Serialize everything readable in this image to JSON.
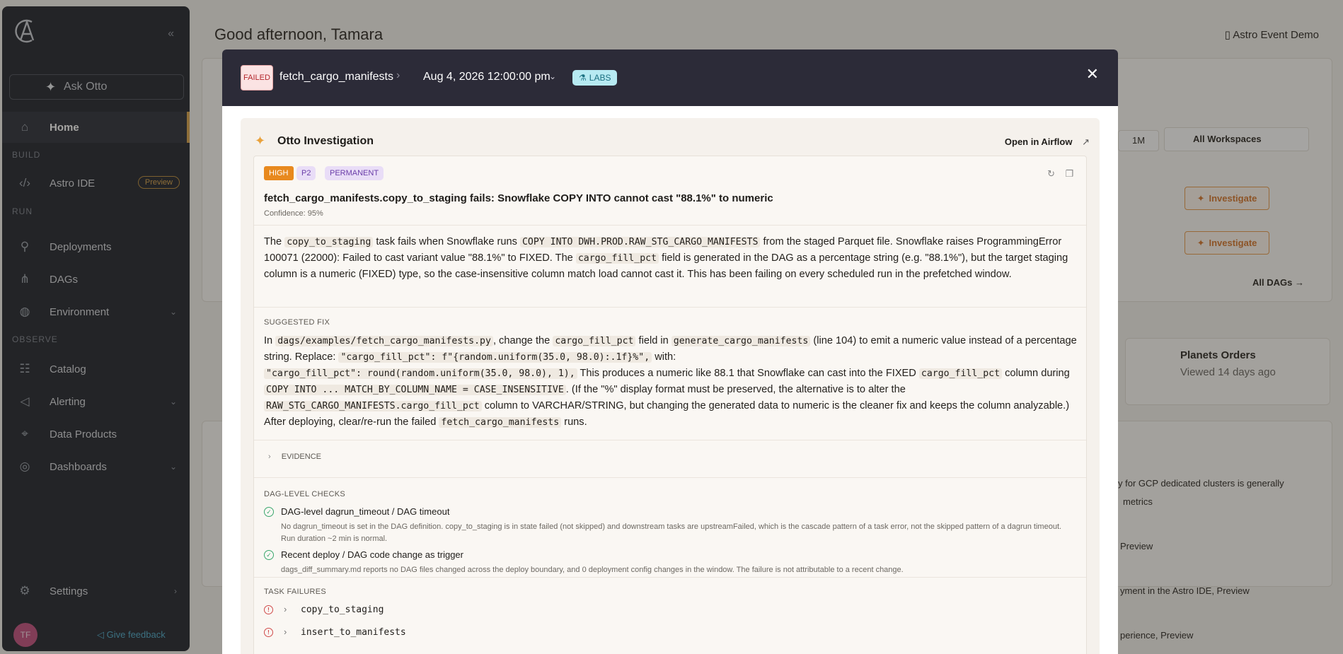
{
  "sidebar": {
    "ask_label": "Ask Otto",
    "sections": [
      "BUILD",
      "RUN",
      "OBSERVE"
    ],
    "items": [
      {
        "label": "Home"
      },
      {
        "label": "Astro IDE",
        "badge": "Preview"
      },
      {
        "label": "Deployments"
      },
      {
        "label": "DAGs"
      },
      {
        "label": "Environment"
      },
      {
        "label": "Catalog"
      },
      {
        "label": "Alerting"
      },
      {
        "label": "Data Products"
      },
      {
        "label": "Dashboards"
      },
      {
        "label": "Settings"
      }
    ],
    "avatar_initials": "TF",
    "feedback_label": "Give feedback"
  },
  "background": {
    "greeting": "Good afternoon, Tamara",
    "org_name": "Astro Event Demo",
    "range_1m": "1M",
    "workspaces": "All Workspaces",
    "investigate_label": "Investigate",
    "all_dags": "All DAGs",
    "planets_title": "Planets Orders",
    "planets_sub": "Viewed 14 days ago",
    "news_1": "y for GCP dedicated clusters is generally",
    "news_2": "metrics",
    "news_3": "Preview",
    "news_4": "yment in the Astro IDE, Preview",
    "news_5": "perience, Preview"
  },
  "modal": {
    "status": "FAILED",
    "dag_id": "fetch_cargo_manifests",
    "run_date": "Aug 4, 2026 12:00:00 pm",
    "labs_label": "LABS",
    "panel_title": "Otto Investigation",
    "open_airflow": "Open in Airflow",
    "tags": {
      "severity": "HIGH",
      "priority": "P2",
      "kind": "PERMANENT"
    },
    "finding_title": "fetch_cargo_manifests.copy_to_staging fails: Snowflake COPY INTO cannot cast \"88.1%\" to numeric",
    "confidence": "Confidence: 95%",
    "summary": {
      "t1": "The ",
      "c1": "copy_to_staging",
      "t2": " task fails when Snowflake runs ",
      "c2": "COPY INTO DWH.PROD.RAW_STG_CARGO_MANIFESTS",
      "t3": " from the staged Parquet file. Snowflake raises ProgrammingError 100071 (22000): Failed to cast variant value \"88.1%\" to FIXED. The ",
      "c3": "cargo_fill_pct",
      "t4": " field is generated in the DAG as a percentage string (e.g. \"88.1%\"), but the target staging column is a numeric (FIXED) type, so the case-insensitive column match load cannot cast it. This has been failing on every scheduled run in the prefetched window."
    },
    "suggested_fix_label": "SUGGESTED FIX",
    "fix": {
      "t1": "In ",
      "c1": "dags/examples/fetch_cargo_manifests.py",
      "t2": ", change the ",
      "c2": "cargo_fill_pct",
      "t3": " field in ",
      "c3": "generate_cargo_manifests",
      "t4": " (line 104) to emit a numeric value instead of a percentage string. Replace: ",
      "c4": "\"cargo_fill_pct\": f\"{random.uniform(35.0, 98.0):.1f}%\",",
      "t5": " with:",
      "c5": "\"cargo_fill_pct\": round(random.uniform(35.0, 98.0), 1),",
      "t6": " This produces a numeric like 88.1 that Snowflake can cast into the FIXED ",
      "c6": "cargo_fill_pct",
      "t7": " column during ",
      "c7": "COPY INTO ... MATCH_BY_COLUMN_NAME = CASE_INSENSITIVE",
      "t8": ". (If the \"%\" display format must be preserved, the alternative is to alter the ",
      "c8": "RAW_STG_CARGO_MANIFESTS.cargo_fill_pct",
      "t9": " column to VARCHAR/STRING, but changing the generated data to numeric is the cleaner fix and keeps the column analyzable.) After deploying, clear/re-run the failed ",
      "c9": "fetch_cargo_manifests",
      "t10": " runs."
    },
    "evidence_label": "EVIDENCE",
    "checks_label": "DAG-LEVEL CHECKS",
    "checks": [
      {
        "title": "DAG-level dagrun_timeout / DAG timeout",
        "desc": "No dagrun_timeout is set in the DAG definition. copy_to_staging is in state failed (not skipped) and downstream tasks are upstreamFailed, which is the cascade pattern of a task error, not the skipped pattern of a dagrun timeout. Run duration ~2 min is normal."
      },
      {
        "title": "Recent deploy / DAG code change as trigger",
        "desc": "dags_diff_summary.md reports no DAG files changed across the deploy boundary, and 0 deployment config changes in the window. The failure is not attributable to a recent change."
      }
    ],
    "task_failures_label": "TASK FAILURES",
    "task_failures": [
      "copy_to_staging",
      "insert_to_manifests"
    ]
  },
  "colors": {
    "sidebar_bg": "#1f232b",
    "modal_header": "#2c2b38",
    "accent": "#d8a24a",
    "fail_red": "#b3262b",
    "labs": "#b7eaf2"
  }
}
